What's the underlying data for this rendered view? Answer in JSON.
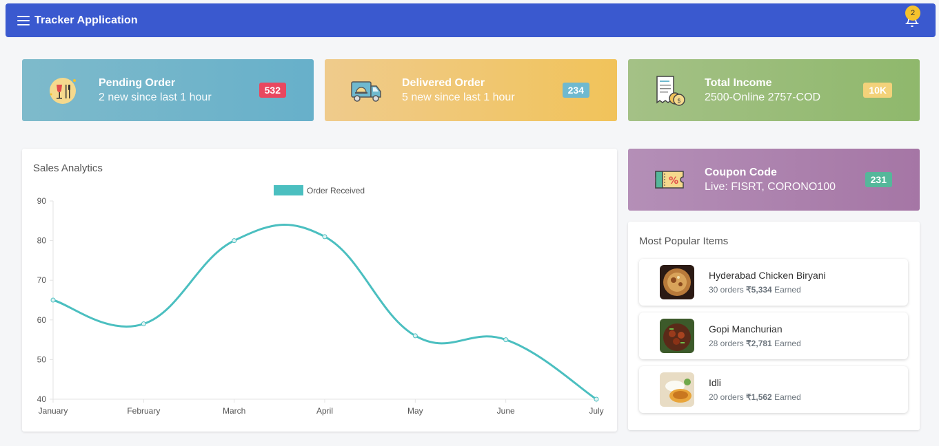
{
  "header": {
    "title": "Tracker Application",
    "notification_count": "2"
  },
  "stats": [
    {
      "title": "Pending Order",
      "subtitle": "2 new since last 1 hour",
      "badge": "532",
      "badge_color": "#e9475f",
      "bg_from": "#7ebacb",
      "bg_to": "#67b0ca"
    },
    {
      "title": "Delivered Order",
      "subtitle": "5 new since last 1 hour",
      "badge": "234",
      "badge_color": "#6fb9cf",
      "bg_from": "#efcb8c",
      "bg_to": "#f1c35a"
    },
    {
      "title": "Total Income",
      "subtitle": "2500-Online 2757-COD",
      "badge": "10K",
      "badge_color": "#f3d27a",
      "bg_from": "#a4c186",
      "bg_to": "#8fb86c"
    },
    {
      "title": "Coupon Code",
      "subtitle": "Live: FISRT, CORONO100",
      "badge": "231",
      "badge_color": "#55b79a",
      "bg_from": "#b48fb7",
      "bg_to": "#a576a5"
    }
  ],
  "sales": {
    "title": "Sales Analytics"
  },
  "chart_data": {
    "type": "line",
    "title": "",
    "categories": [
      "January",
      "February",
      "March",
      "April",
      "May",
      "June",
      "July"
    ],
    "series": [
      {
        "name": "Order Received",
        "values": [
          65,
          59,
          80,
          81,
          56,
          55,
          40
        ],
        "color": "#4bbfc0"
      }
    ],
    "ylim": [
      40,
      90
    ],
    "yticks": [
      40,
      50,
      60,
      70,
      80,
      90
    ],
    "legend": "top"
  },
  "popular": {
    "title": "Most Popular Items",
    "items": [
      {
        "name": "Hyderabad Chicken Biryani",
        "orders": "30 orders",
        "amount": "₹5,334",
        "earned": "Earned"
      },
      {
        "name": "Gopi Manchurian",
        "orders": "28 orders",
        "amount": "₹2,781",
        "earned": "Earned"
      },
      {
        "name": "Idli",
        "orders": "20 orders",
        "amount": "₹1,562",
        "earned": "Earned"
      }
    ]
  }
}
